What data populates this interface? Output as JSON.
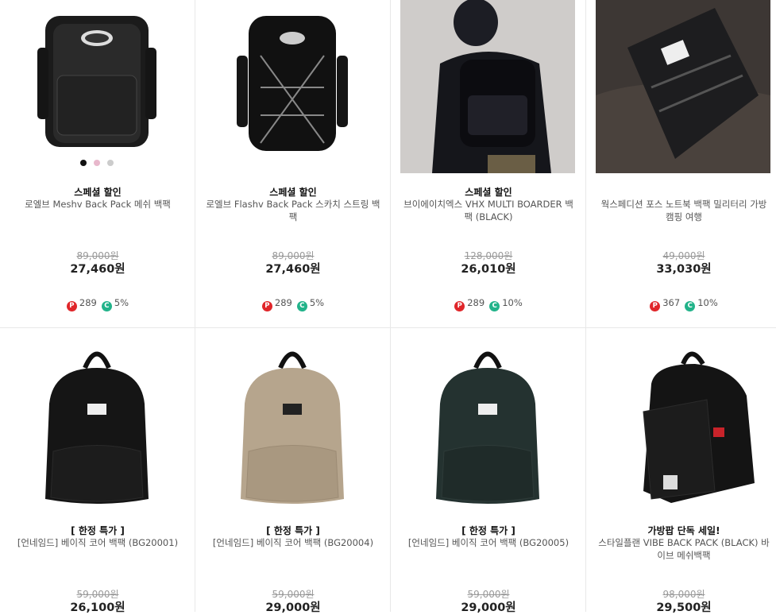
{
  "products": [
    {
      "badge": "스페셜 할인",
      "name": "로엘브 Meshv Back Pack 메쉬 백팩",
      "original_price": "89,000원",
      "price": "27,460원",
      "points": "289",
      "coupon": "5%",
      "icon_p": "P",
      "icon_c": "C"
    },
    {
      "badge": "스페셜 할인",
      "name": "로엘브 Flashv Back Pack 스카치 스트링 백팩",
      "original_price": "89,000원",
      "price": "27,460원",
      "points": "289",
      "coupon": "5%",
      "icon_p": "P",
      "icon_c": "C"
    },
    {
      "badge": "스페셜 할인",
      "name": "브이에이치엑스 VHX MULTI BOARDER 백팩 (BLACK)",
      "original_price": "128,000원",
      "price": "26,010원",
      "points": "289",
      "coupon": "10%",
      "icon_p": "P",
      "icon_c": "C"
    },
    {
      "badge": "",
      "name": "웍스페디션 포스 노트북 백팩 밀리터리 가방 캠핑 여행",
      "original_price": "49,000원",
      "price": "33,030원",
      "points": "367",
      "coupon": "10%",
      "icon_p": "P",
      "icon_c": "C"
    },
    {
      "badge": "[ 한정 특가 ]",
      "name": "[언네임드] 베이직 코어 백팩 (BG20001)",
      "original_price": "59,000원",
      "price": "26,100원"
    },
    {
      "badge": "[ 한정 특가 ]",
      "name": "[언네임드] 베이직 코어 백팩 (BG20004)",
      "original_price": "59,000원",
      "price": "29,000원"
    },
    {
      "badge": "[ 한정 특가 ]",
      "name": "[언네임드] 베이직 코어 백팩 (BG20005)",
      "original_price": "59,000원",
      "price": "29,000원"
    },
    {
      "badge": "가방팝 단독 세일!",
      "name": "스타일플랜 VIBE BACK PACK (BLACK) 바이브 메쉬백팩",
      "original_price": "98,000원",
      "price": "29,500원"
    }
  ],
  "color_swatches": [
    "#111111",
    "#e8b8cc",
    "#cccccc"
  ]
}
